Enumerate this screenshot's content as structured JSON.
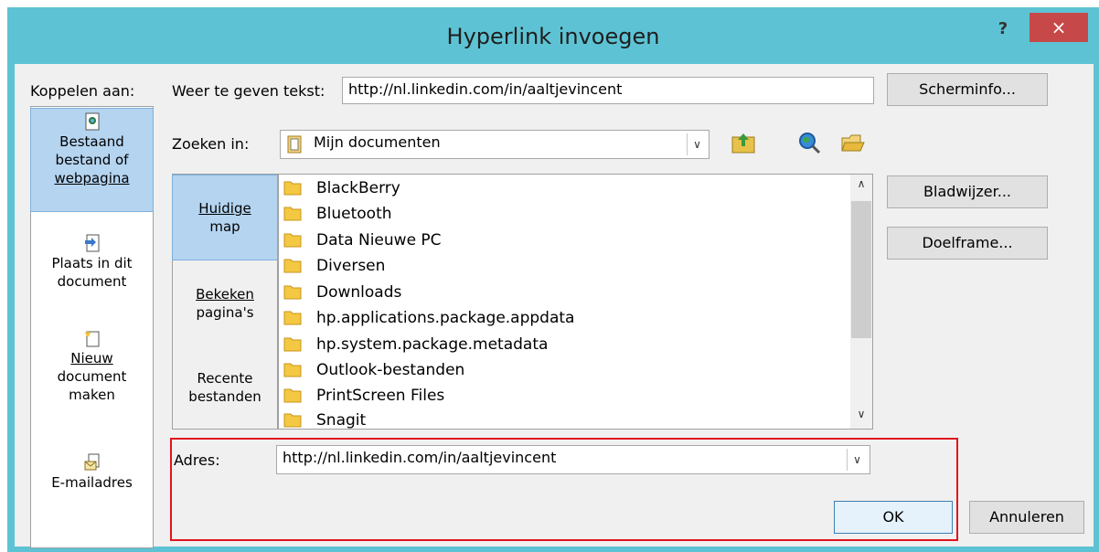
{
  "window": {
    "title": "Hyperlink invoegen",
    "help_glyph": "?",
    "close_glyph": "×"
  },
  "link_to": {
    "label": "Koppelen aan:",
    "items": [
      {
        "label_lines": [
          "Bestaand",
          "bestand of",
          "webpagina"
        ],
        "icon": "existing-file-icon",
        "selected": true
      },
      {
        "label_lines": [
          "Plaats in dit",
          "document"
        ],
        "icon": "place-in-document-icon",
        "selected": false
      },
      {
        "label_lines": [
          "Nieuw",
          "document",
          "maken"
        ],
        "icon": "new-document-icon",
        "selected": false
      },
      {
        "label_lines": [
          "E-mailadres"
        ],
        "icon": "email-icon",
        "selected": false
      }
    ]
  },
  "display_text": {
    "label": "Weer te geven tekst:",
    "value": "http://nl.linkedin.com/in/aaltjevincent"
  },
  "buttons": {
    "screentip": "Scherminfo...",
    "bookmark": "Bladwijzer...",
    "target_frame": "Doelframe...",
    "ok": "OK",
    "cancel": "Annuleren"
  },
  "look_in": {
    "label": "Zoeken in:",
    "value": "Mijn documenten"
  },
  "nav": {
    "items": [
      {
        "label_lines": [
          "Huidige",
          "map"
        ],
        "selected": true
      },
      {
        "label_lines": [
          "Bekeken",
          "pagina's"
        ],
        "selected": false
      },
      {
        "label_lines": [
          "Recente",
          "bestanden"
        ],
        "selected": false
      }
    ]
  },
  "files": [
    "BlackBerry",
    "Bluetooth",
    "Data Nieuwe PC",
    "Diversen",
    "Downloads",
    "hp.applications.package.appdata",
    "hp.system.package.metadata",
    "Outlook-bestanden",
    "PrintScreen Files",
    "Snagit"
  ],
  "address": {
    "label": "Adres:",
    "value": "http://nl.linkedin.com/in/aaltjevincent"
  },
  "colors": {
    "title_bar": "#5dc3d4",
    "close_button": "#c74848",
    "selection": "#b4d4f0",
    "highlight_box": "#e0141e"
  }
}
